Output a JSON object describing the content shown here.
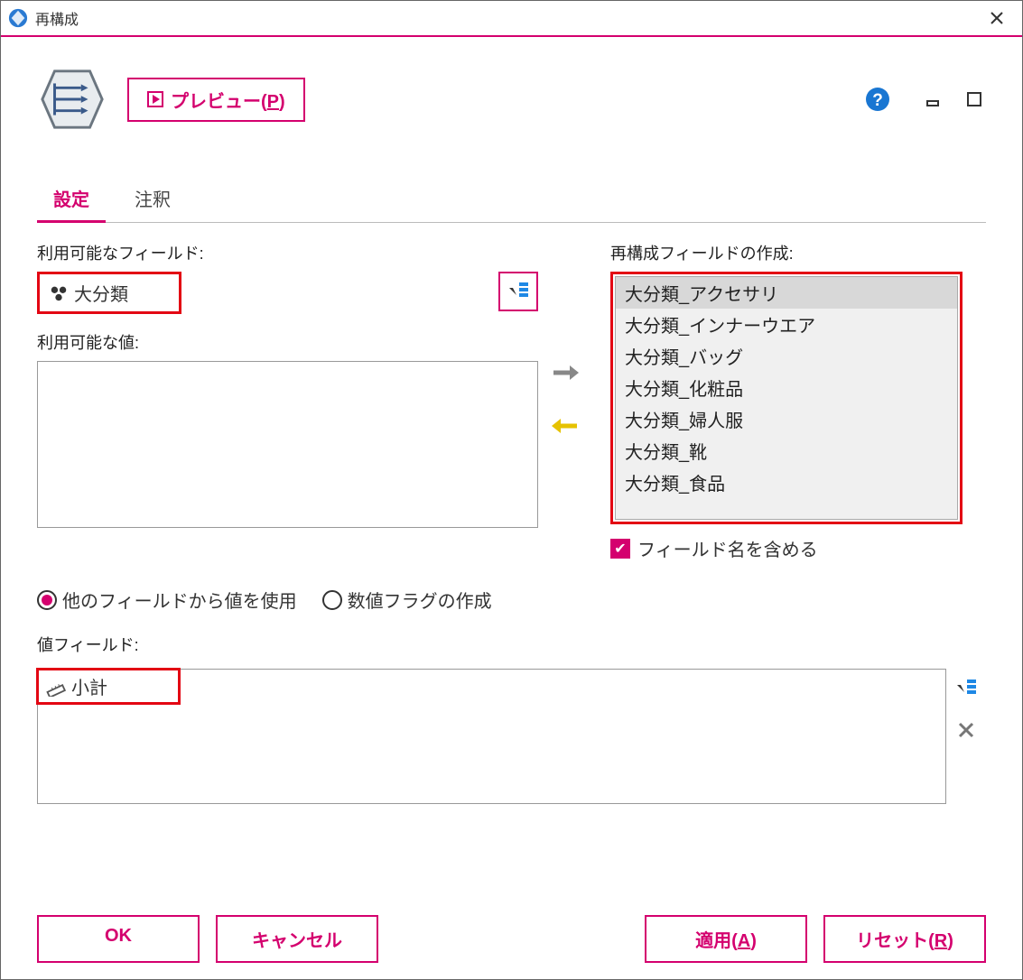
{
  "window": {
    "title": "再構成"
  },
  "toolbar": {
    "preview_label": "プレビュー(",
    "preview_mnemonic": "P",
    "preview_suffix": ")"
  },
  "tabs": {
    "settings": "設定",
    "annotation": "注釈"
  },
  "labels": {
    "available_fields": "利用可能なフィールド:",
    "available_values": "利用可能な値:",
    "create_restructure_fields": "再構成フィールドの作成:",
    "value_field": "値フィールド:"
  },
  "available_field_selected": "大分類",
  "restructure_fields": [
    "大分類_アクセサリ",
    "大分類_インナーウエア",
    "大分類_バッグ",
    "大分類_化粧品",
    "大分類_婦人服",
    "大分類_靴",
    "大分類_食品"
  ],
  "restructure_selected_index": 0,
  "include_field_name": {
    "checked": true,
    "label": "フィールド名を含める"
  },
  "radio": {
    "use_other_field_label": "他のフィールドから値を使用",
    "numeric_flag_label": "数値フラグの作成",
    "selected": "use_other_field"
  },
  "value_field_selected": "小計",
  "buttons": {
    "ok": "OK",
    "cancel": "キャンセル",
    "apply": "適用(",
    "apply_mn": "A",
    "apply_suf": ")",
    "reset": "リセット(",
    "reset_mn": "R",
    "reset_suf": ")"
  }
}
